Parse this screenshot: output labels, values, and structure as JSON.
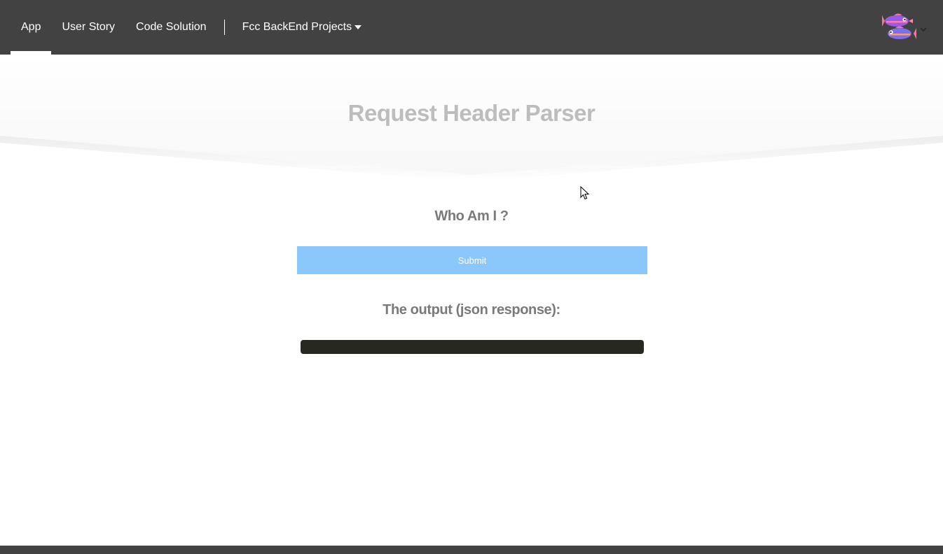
{
  "nav": {
    "items": [
      {
        "label": "App",
        "active": true
      },
      {
        "label": "User Story",
        "active": false
      },
      {
        "label": "Code Solution",
        "active": false
      }
    ],
    "dropdown": {
      "label": "Fcc BackEnd Projects"
    },
    "user_avatar_icon": "fish-avatar-icon"
  },
  "main": {
    "title": "Request Header Parser",
    "whoami_heading": "Who Am I ?",
    "submit_label": "Submit",
    "output_heading": "The output (json response):",
    "output_value": ""
  },
  "colors": {
    "navbar_bg": "#424242",
    "submit_bg": "#8ac8fb",
    "output_bg": "#272822",
    "title_color": "#bdbdbd"
  }
}
